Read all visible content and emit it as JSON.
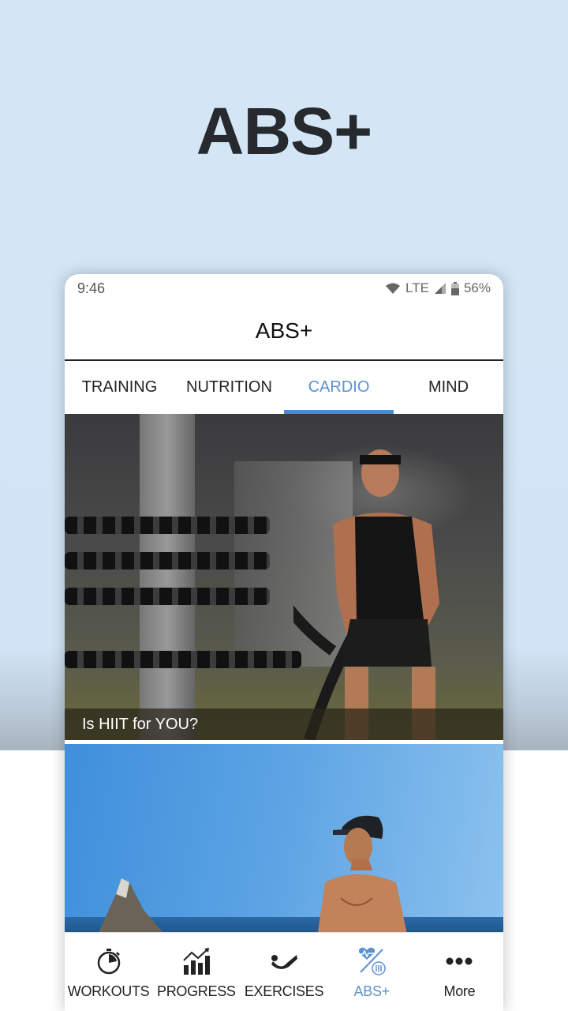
{
  "promo": {
    "title": "ABS+"
  },
  "status_bar": {
    "time": "9:46",
    "network": "LTE",
    "battery": "56%"
  },
  "header": {
    "title": "ABS+"
  },
  "tabs": [
    {
      "label": "TRAINING",
      "active": false
    },
    {
      "label": "NUTRITION",
      "active": false
    },
    {
      "label": "CARDIO",
      "active": true
    },
    {
      "label": "MIND",
      "active": false
    }
  ],
  "cards": [
    {
      "caption": "Is HIIT for YOU?",
      "image": "battle-ropes-gym-photo"
    },
    {
      "caption": "",
      "image": "beach-shirtless-man-photo"
    }
  ],
  "bottom_nav": [
    {
      "label": "WORKOUTS",
      "icon": "stopwatch-icon",
      "active": false
    },
    {
      "label": "PROGRESS",
      "icon": "bar-chart-trend-icon",
      "active": false
    },
    {
      "label": "EXERCISES",
      "icon": "situp-figure-icon",
      "active": false
    },
    {
      "label": "ABS+",
      "icon": "heart-nutrition-icon",
      "active": true
    },
    {
      "label": "More",
      "icon": "more-dots-icon",
      "active": false
    }
  ],
  "colors": {
    "accent": "#5b92cf",
    "background": "#d4e6f6",
    "text": "#222222"
  }
}
